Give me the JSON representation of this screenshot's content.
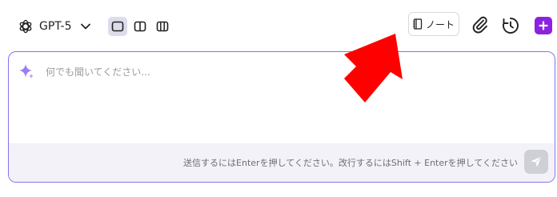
{
  "toolbar": {
    "model_name": "GPT-5",
    "model_icon": "openai-logo-icon",
    "layout_options": [
      "single-pane-icon",
      "two-pane-icon",
      "three-pane-icon"
    ],
    "note_label": "ノート",
    "accent_color": "#8b22e0"
  },
  "chat": {
    "placeholder": "何でも聞いてください...",
    "hint": "送信するにはEnterを押してください。改行するにはShift + Enterを押してください",
    "border_color": "#8b6ff0"
  },
  "annotation": {
    "arrow_color": "#ff0000"
  }
}
